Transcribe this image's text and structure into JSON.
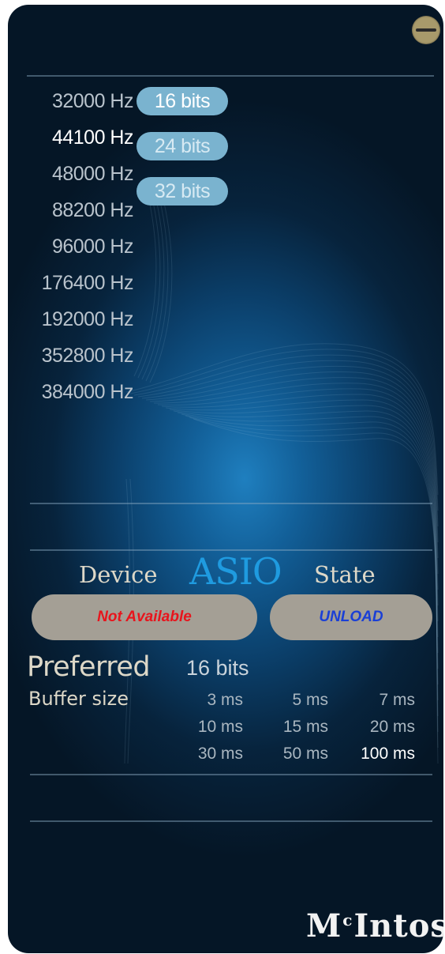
{
  "window": {
    "minimize_icon": "minus-circle-icon"
  },
  "sample_rates": {
    "options": [
      "32000 Hz",
      "44100 Hz",
      "48000 Hz",
      "88200 Hz",
      "96000 Hz",
      "176400 Hz",
      "192000 Hz",
      "352800 Hz",
      "384000 Hz"
    ],
    "selected": "44100 Hz"
  },
  "bit_depths": {
    "options": [
      "16 bits",
      "24 bits",
      "32 bits"
    ],
    "selected": "16 bits"
  },
  "asio": {
    "device_label": "Device",
    "title": "ASIO",
    "state_label": "State",
    "device_value": "Not Available",
    "device_value_color": "#e8141c",
    "state_button": "UNLOAD",
    "state_button_color": "#1a3fd6"
  },
  "preferred": {
    "label": "Preferred",
    "bits": "16 bits",
    "buffer_label": "Buffer size",
    "buffer_options": [
      "3 ms",
      "5 ms",
      "7 ms",
      "10 ms",
      "15 ms",
      "20 ms",
      "30 ms",
      "50 ms",
      "100 ms"
    ],
    "selected": "100 ms"
  },
  "brand": {
    "logo_main": "M",
    "logo_sup": "c",
    "logo_rest": "Intosh"
  }
}
